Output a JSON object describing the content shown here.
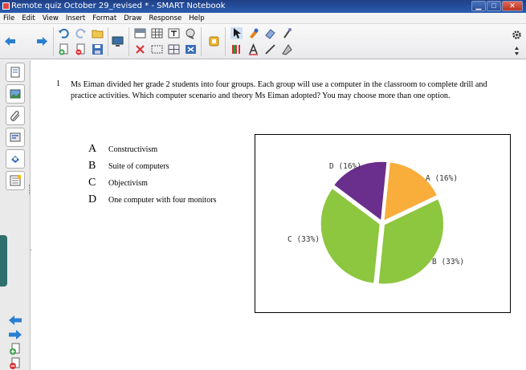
{
  "window": {
    "title": "Remote quiz October 29_revised * - SMART Notebook",
    "minimize": "▁",
    "maximize": "□",
    "close": "✕"
  },
  "menu": [
    "File",
    "Edit",
    "View",
    "Insert",
    "Format",
    "Draw",
    "Response",
    "Help"
  ],
  "question": {
    "number": "1",
    "text": "Ms Eiman divided her grade 2 students into four groups. Each group will use a computer in the classroom to complete drill and practice activities. Which computer scenario and theory Ms Eiman adopted? You may choose more than one option."
  },
  "options": [
    {
      "letter": "A",
      "text": "Constructivism"
    },
    {
      "letter": "B",
      "text": "Suite of computers"
    },
    {
      "letter": "C",
      "text": "Objectivism"
    },
    {
      "letter": "D",
      "text": "One computer with four monitors"
    }
  ],
  "colors": {
    "A": "#f9ad3a",
    "B": "#8dc63f",
    "C": "#8dc63f",
    "D": "#6a2e8c"
  },
  "chart_data": {
    "type": "pie",
    "slices": [
      {
        "name": "A",
        "value": 16,
        "label": "A (16%)"
      },
      {
        "name": "B",
        "value": 33,
        "label": "B (33%)"
      },
      {
        "name": "C",
        "value": 33,
        "label": "C (33%)"
      },
      {
        "name": "D",
        "value": 16,
        "label": "D (16%)"
      }
    ]
  }
}
